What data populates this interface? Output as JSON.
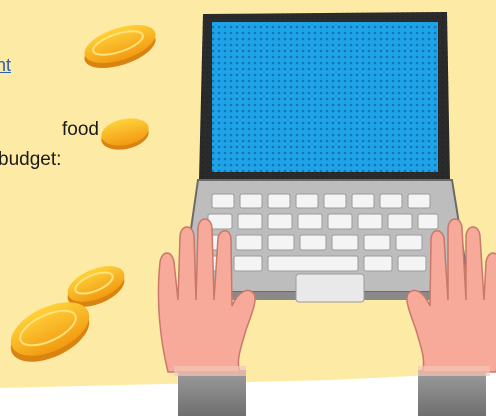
{
  "content": {
    "link_fragment": "ht",
    "line1": "food",
    "line2": "budget:"
  },
  "colors": {
    "background": "#fdeaa4",
    "link": "#2f5fa8",
    "screen": "#1ea3e8",
    "laptop_body": "#bfbfbf",
    "coin": "#f6a91a",
    "hand": "#f7a99a",
    "sleeve": "#8f8f8f"
  },
  "icons": [
    "coin-icon",
    "laptop-icon",
    "hand-icon",
    "keyboard-icon"
  ]
}
